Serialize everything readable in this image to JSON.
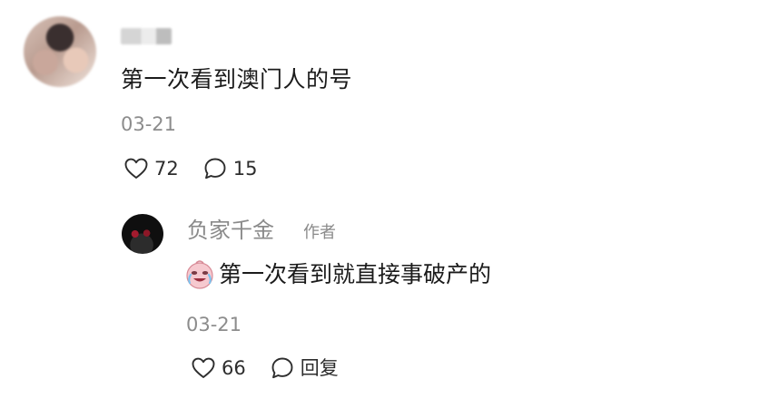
{
  "comment": {
    "content": "第一次看到澳门人的号",
    "date": "03-21",
    "likes": "72",
    "replies": "15"
  },
  "reply": {
    "author": "负家千金",
    "author_tag": "作者",
    "emoji": "cry-laugh-face-emoji",
    "content": "第一次看到就直接事破产的",
    "date": "03-21",
    "likes": "66",
    "reply_label": "回复"
  },
  "icons": {
    "like": "heart-outline-icon",
    "comment": "speech-bubble-icon"
  },
  "colors": {
    "text_primary": "#1b1b1b",
    "text_secondary": "#8c8c8c",
    "background": "#ffffff"
  }
}
